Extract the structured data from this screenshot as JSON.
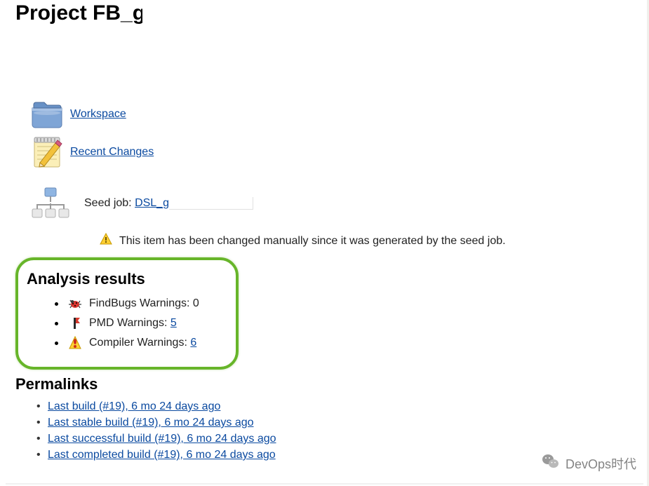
{
  "title_prefix": "Project FB_g",
  "links": {
    "workspace": "Workspace",
    "recent_changes": "Recent Changes"
  },
  "seed": {
    "label_prefix": "Seed job: ",
    "link_text": "DSL_g",
    "warning": "This item has been changed manually since it was generated by the seed job."
  },
  "analysis": {
    "heading": "Analysis results",
    "items": [
      {
        "icon": "findbugs-icon",
        "label": "FindBugs Warnings: ",
        "count": "0",
        "is_link": false
      },
      {
        "icon": "pmd-icon",
        "label": "PMD Warnings: ",
        "count": "5",
        "is_link": true
      },
      {
        "icon": "compiler-icon",
        "label": "Compiler Warnings: ",
        "count": "6",
        "is_link": true
      }
    ]
  },
  "permalinks": {
    "heading": "Permalinks",
    "items": [
      "Last build (#19), 6 mo 24 days ago",
      "Last stable build (#19), 6 mo 24 days ago",
      "Last successful build (#19), 6 mo 24 days ago",
      "Last completed build (#19), 6 mo 24 days ago"
    ]
  },
  "watermark": "DevOps时代"
}
